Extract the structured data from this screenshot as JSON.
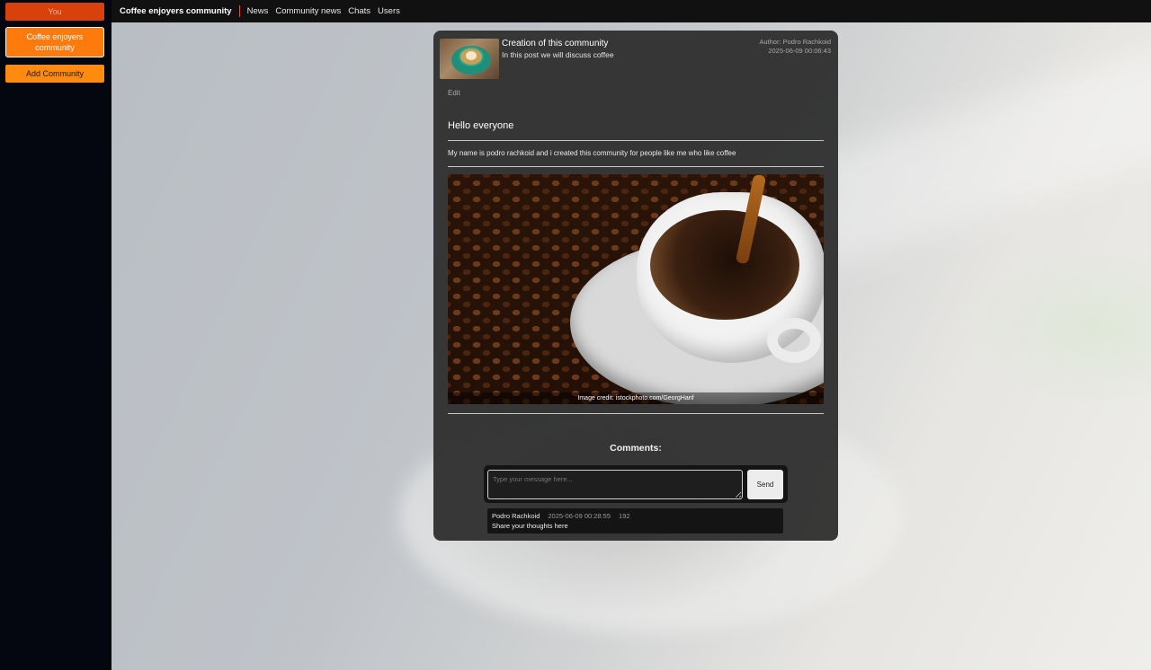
{
  "sidebar": {
    "you_label": "You",
    "community_label": "Coffee enjoyers community",
    "add_label": "Add Community"
  },
  "topbar": {
    "brand": "Coffee enjoyers community",
    "nav": [
      "News",
      "Community news",
      "Chats",
      "Users"
    ]
  },
  "post": {
    "title": "Creation of this community",
    "subtitle": "In this post we will discuss coffee",
    "author": "Author: Podro Rachkoid",
    "date": "2025-06-09 00:06:43",
    "edit_label": "Edit",
    "heading": "Hello everyone",
    "body": "My name is podro rachkoid and i created this community for people like me who like coffee",
    "image_credit": "Image credit: istockphoto.com/GeorgHanf"
  },
  "comments": {
    "title": "Comments:",
    "input_placeholder": "Type your message here...",
    "send_label": "Send",
    "items": [
      {
        "author": "Podro Rachkoid",
        "date": "2025-06-09 00:28:55",
        "count": "192",
        "text": "Share your thoughts here"
      }
    ]
  },
  "colors": {
    "accent": "#ff7a0d",
    "you_button": "#d8400c",
    "card_bg": "#303030",
    "topbar_bg": "#111111"
  }
}
